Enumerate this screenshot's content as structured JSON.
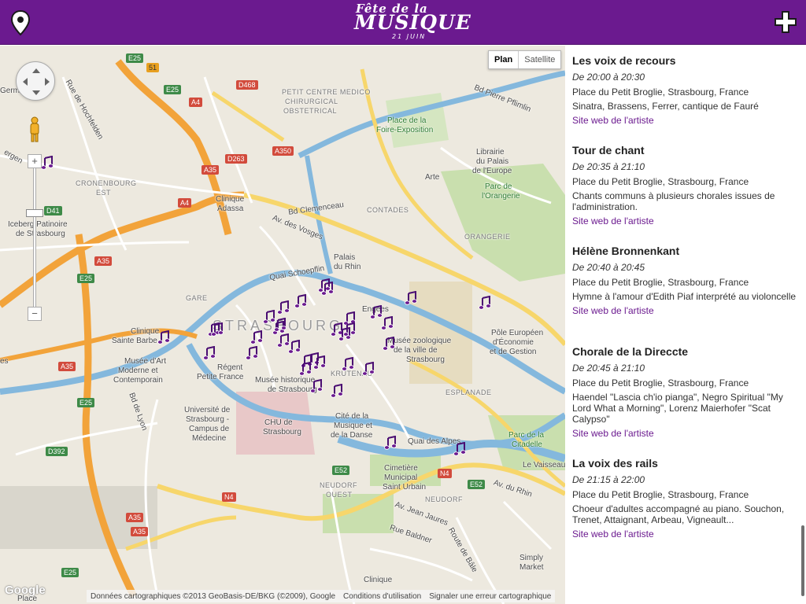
{
  "header": {
    "logo_line1": "Fête de la",
    "logo_line2": "MUSIQUE",
    "logo_line3": "21 JUIN",
    "bg_color": "#6b1a8f"
  },
  "map": {
    "type_plan": "Plan",
    "type_satellite": "Satellite",
    "zoom_in": "+",
    "zoom_out": "−",
    "attribution": "Données cartographiques ©2013 GeoBasis-DE/BKG (©2009), Google",
    "terms": "Conditions d'utilisation",
    "report": "Signaler une erreur cartographique",
    "google": "Google",
    "labels": {
      "strasbourg": "STRASBOURG",
      "petit_centre_medico": "PETIT CENTRE MEDICO",
      "chirurgical": "CHIRURGICAL",
      "obstetrical": "OBSTETRICAL",
      "place_foire": "Place de la",
      "foire_exposition": "Foire-Exposition",
      "bd_pierre": "Bd Pierre Pflimlin",
      "librairie": "Librairie",
      "palais_europe": "du Palais",
      "de_europe": "de l'Europe",
      "arte": "Arte",
      "parc_orangerie": "Parc de",
      "orangerie": "l'Orangerie",
      "orangerie_dist": "ORANGERIE",
      "cronenbourg": "CRONENBOURG",
      "est": "EST",
      "clinique_adassa": "Clinique",
      "adassa": "Adassa",
      "bd_clemenceau": "Bd Clemenceau",
      "contades": "CONTADES",
      "av_vosges": "Av. des Vosges",
      "iceberg": "Iceberg Patinoire",
      "de_strasbourg": "de Strasbourg",
      "palais_rhin": "Palais",
      "du_rhin": "du Rhin",
      "quai_schoepflin": "Quai Schoepflin",
      "gare": "GARE",
      "engees": "Engees",
      "clinique_sb": "Clinique",
      "sainte_barbe": "Sainte Barbe",
      "musee_art": "Musée d'Art",
      "moderne": "Moderne et",
      "contemporain": "Contemporain",
      "regent": "Régent",
      "petite_france": "Petite France",
      "musee_historique": "Musée historique",
      "de_strasbourg2": "de Strasbourg",
      "musee_zoo": "Musée zoologique",
      "de_la_ville": "de la ville de",
      "strasbourg3": "Strasbourg",
      "krutenau": "KRUTENAU",
      "esplanade": "ESPLANADE",
      "pole_europeen": "Pôle Européen",
      "economie": "d'Économie",
      "et_gestion": "et de Gestion",
      "universite": "Université de",
      "strasbourg_u": "Strasbourg -",
      "campus": "Campus de",
      "medecine": "Médecine",
      "chu": "CHU de",
      "strasbourg_chu": "Strasbourg",
      "cite_musique": "Cité de la",
      "musique_danse": "Musique et",
      "de_la_danse": "de la Danse",
      "quai_alpes": "Quai des Alpes",
      "parc_citadelle": "Parc de la",
      "citadelle": "Citadelle",
      "le_vaisseau": "Le Vaisseau",
      "cimetiere": "Cimetière",
      "municipal": "Municipal",
      "saint_urbain": "Saint Urbain",
      "neudorf_ouest": "NEUDORF",
      "ouest": "OUEST",
      "neudorf": "NEUDORF",
      "av_rhin": "Av. du Rhin",
      "av_jean_jaures": "Av. Jean Jaures",
      "rte_baldner": "Rue Baldner",
      "rte_bale": "Route de Bâle",
      "simply_market": "Simply",
      "market": "Market",
      "clinique_bottom": "Clinique",
      "place_bottom": "Place",
      "bd_lyon": "Bd de Lyon",
      "rue_hochfelden": "Rue de Hochfelden",
      "ergen": "ergen",
      "germ": "Germ",
      "es": "es"
    },
    "shields": {
      "e25_top": "E25",
      "n51": "51",
      "d468": "D468",
      "e25_mid": "E25",
      "a4_a": "A4",
      "d263": "D263",
      "a350": "A350",
      "a35_a": "A35",
      "a4_b": "A4",
      "d41": "D41",
      "a35_b": "A35",
      "e25_c": "E25",
      "a35_c": "A35",
      "e25_d": "E25",
      "d392": "D392",
      "e52_a": "E52",
      "n4_a": "N4",
      "e52_b": "E52",
      "n4_b": "N4",
      "a35_d": "A35",
      "a35_e": "A35",
      "e25_e": "E25"
    }
  },
  "events": [
    {
      "title": "Les voix de recours",
      "time": "De 20:00 à 20:30",
      "place": "Place du Petit Broglie, Strasbourg, France",
      "desc": "Sinatra, Brassens, Ferrer, cantique de Fauré",
      "link": "Site web de l'artiste"
    },
    {
      "title": "Tour de chant",
      "time": "De 20:35 à 21:10",
      "place": "Place du Petit Broglie, Strasbourg, France",
      "desc": "Chants communs à plusieurs chorales issues de l'administration.",
      "link": "Site web de l'artiste"
    },
    {
      "title": "Hélène Bronnenkant",
      "time": "De 20:40 à 20:45",
      "place": "Place du Petit Broglie, Strasbourg, France",
      "desc": "Hymne à l'amour d'Edith Piaf interprété au violoncelle",
      "link": "Site web de l'artiste"
    },
    {
      "title": "Chorale de la Direccte",
      "time": "De 20:45 à 21:10",
      "place": "Place du Petit Broglie, Strasbourg, France",
      "desc": "Haendel \"Lascia ch'io pianga\", Negro Spiritual \"My Lord What a Morning\", Lorenz Maierhofer \"Scat Calypso\"",
      "link": "Site web de l'artiste"
    },
    {
      "title": "La voix des rails",
      "time": "De 21:15 à 22:00",
      "place": "Place du Petit Broglie, Strasbourg, France",
      "desc": "Choeur d'adultes accompagné au piano. Souchon, Trenet, Attaignant, Arbeau, Vigneault...",
      "link": "Site web de l'artiste"
    }
  ]
}
